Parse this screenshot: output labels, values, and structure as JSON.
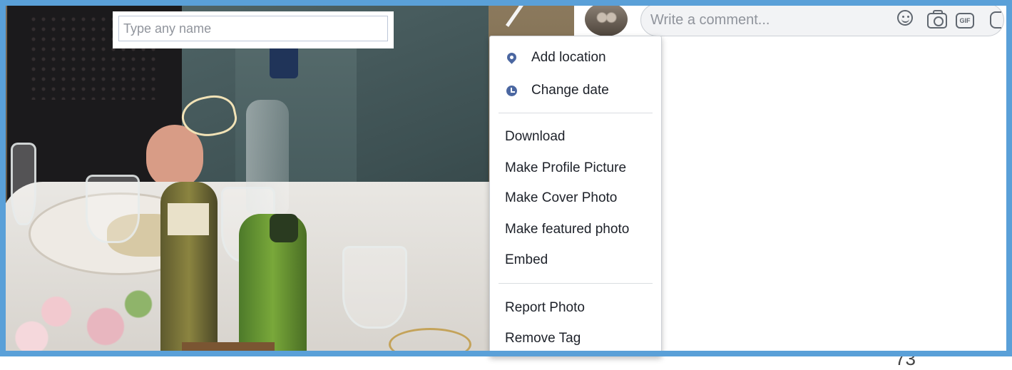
{
  "photo_tag": {
    "placeholder": "Type any name"
  },
  "comment": {
    "placeholder": "Write a comment...",
    "icons": [
      "emoji-icon",
      "camera-icon",
      "gif-icon",
      "sticker-icon"
    ],
    "gif_label": "GIF"
  },
  "menu": {
    "items": [
      {
        "label": "Add location",
        "icon": "location-pin-icon"
      },
      {
        "label": "Change date",
        "icon": "clock-icon"
      },
      {
        "label": "Download"
      },
      {
        "label": "Make Profile Picture"
      },
      {
        "label": "Make Cover Photo"
      },
      {
        "label": "Make featured photo"
      },
      {
        "label": "Embed"
      },
      {
        "label": "Report Photo"
      },
      {
        "label": "Remove Tag"
      }
    ]
  },
  "page_number": "73",
  "colors": {
    "frame": "#5aa0d8",
    "menu_icon": "#4b67a1",
    "text": "#1d2129",
    "placeholder": "#90949c"
  }
}
